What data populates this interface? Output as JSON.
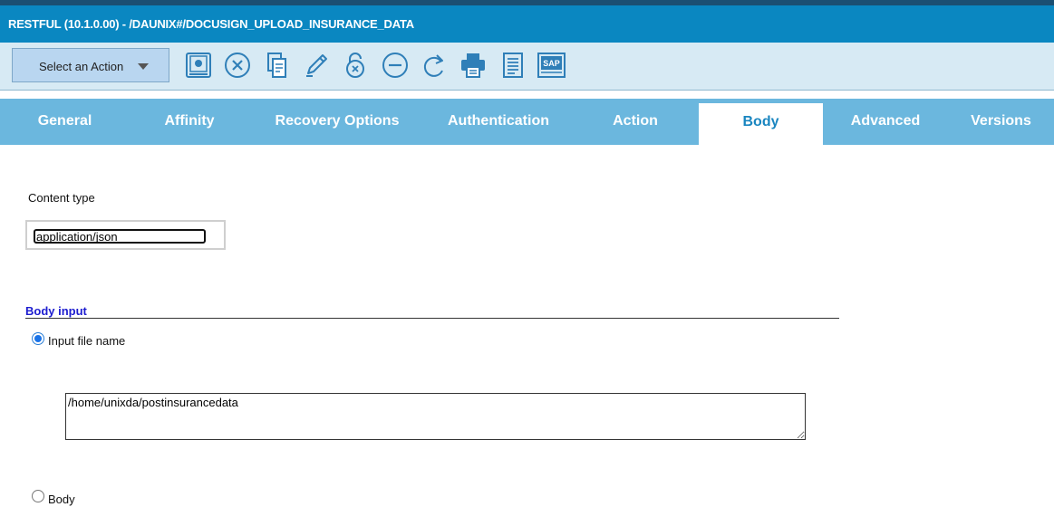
{
  "window": {
    "title": "RESTFUL (10.1.0.00) - /DAUNIX#/DOCUSIGN_UPLOAD_INSURANCE_DATA"
  },
  "toolbar": {
    "action_label": "Select an Action",
    "tools": [
      {
        "name": "save-icon"
      },
      {
        "name": "cancel-icon"
      },
      {
        "name": "copy-icon"
      },
      {
        "name": "edit-icon"
      },
      {
        "name": "unlock-icon"
      },
      {
        "name": "remove-icon"
      },
      {
        "name": "redo-icon"
      },
      {
        "name": "print-icon"
      },
      {
        "name": "document-icon"
      },
      {
        "name": "sap-icon",
        "text": "SAP"
      }
    ]
  },
  "tabs": [
    {
      "label": "General",
      "active": false
    },
    {
      "label": "Affinity",
      "active": false
    },
    {
      "label": "Recovery Options",
      "active": false
    },
    {
      "label": "Authentication",
      "active": false
    },
    {
      "label": "Action",
      "active": false
    },
    {
      "label": "Body",
      "active": true
    },
    {
      "label": "Advanced",
      "active": false
    },
    {
      "label": "Versions",
      "active": false
    }
  ],
  "body": {
    "content_type_label": "Content type",
    "content_type_value": "application/json",
    "body_input_title": "Body input",
    "input_file_label": "Input file name",
    "input_file_selected": true,
    "input_file_value": "/home/unixda/postinsurancedata",
    "body_label": "Body",
    "body_selected": false
  },
  "colors": {
    "title_bar": "#0a87c1",
    "toolbar_bg": "#d7eaf4",
    "tab_bar": "#6bb7de",
    "active_tab_text": "#1a86c0",
    "section_title": "#1c1ccf",
    "icon_blue": "#2f7fb8"
  }
}
